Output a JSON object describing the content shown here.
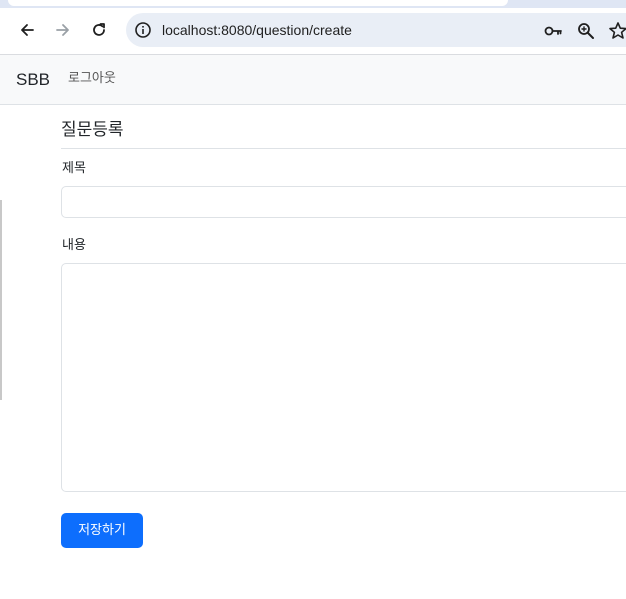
{
  "browser": {
    "url": "localhost:8080/question/create"
  },
  "navbar": {
    "brand": "SBB",
    "logout_label": "로그아웃"
  },
  "form": {
    "title": "질문등록",
    "subject_label": "제목",
    "subject_value": "",
    "content_label": "내용",
    "content_value": "",
    "submit_label": "저장하기"
  },
  "colors": {
    "primary": "#0d6efd",
    "navbar_bg": "#f8f9fa",
    "omnibox_bg": "#e9eef6"
  },
  "icons": [
    "back-arrow-icon",
    "forward-arrow-icon",
    "reload-icon",
    "info-icon",
    "key-icon",
    "zoom-icon",
    "star-icon"
  ]
}
